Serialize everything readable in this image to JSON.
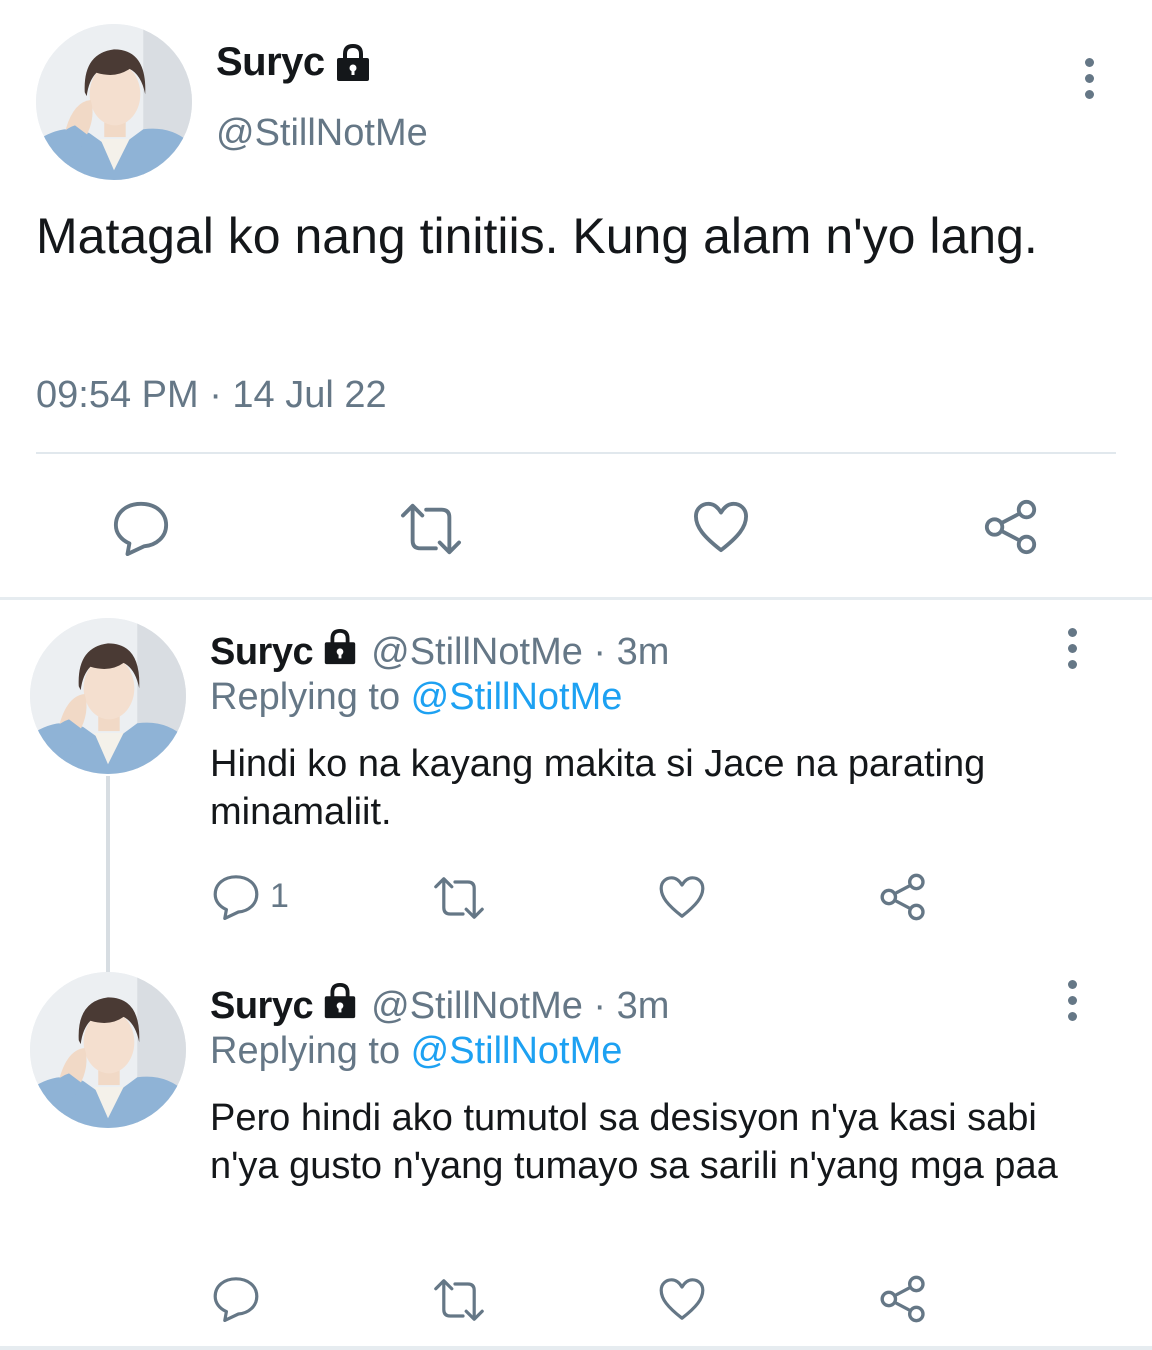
{
  "main": {
    "name": "Suryc",
    "handle": "@StillNotMe",
    "text": "Matagal ko nang tinitiis. Kung alam n'yo lang.",
    "timestamp": "09:54 PM · 14 Jul 22",
    "actions": [
      "reply-icon",
      "retweet-icon",
      "like-icon",
      "share-icon"
    ]
  },
  "replies": [
    {
      "name": "Suryc",
      "handle": "@StillNotMe · 3m",
      "replying_prefix": "Replying to ",
      "replying_handle": "@StillNotMe",
      "text": "Hindi ko na kayang makita si Jace na parating minamaliit.",
      "reply_count": "1"
    },
    {
      "name": "Suryc",
      "handle": "@StillNotMe · 3m",
      "replying_prefix": "Replying to ",
      "replying_handle": "@StillNotMe",
      "text": "Pero hindi ako tumutol sa desisyon n'ya kasi sabi n'ya gusto n'yang tumayo sa sarili n'yang mga paa",
      "reply_count": ""
    }
  ],
  "colors": {
    "text": "#14171a",
    "secondary": "#657786",
    "link": "#1da1f2",
    "divider": "#e1e8ed"
  }
}
